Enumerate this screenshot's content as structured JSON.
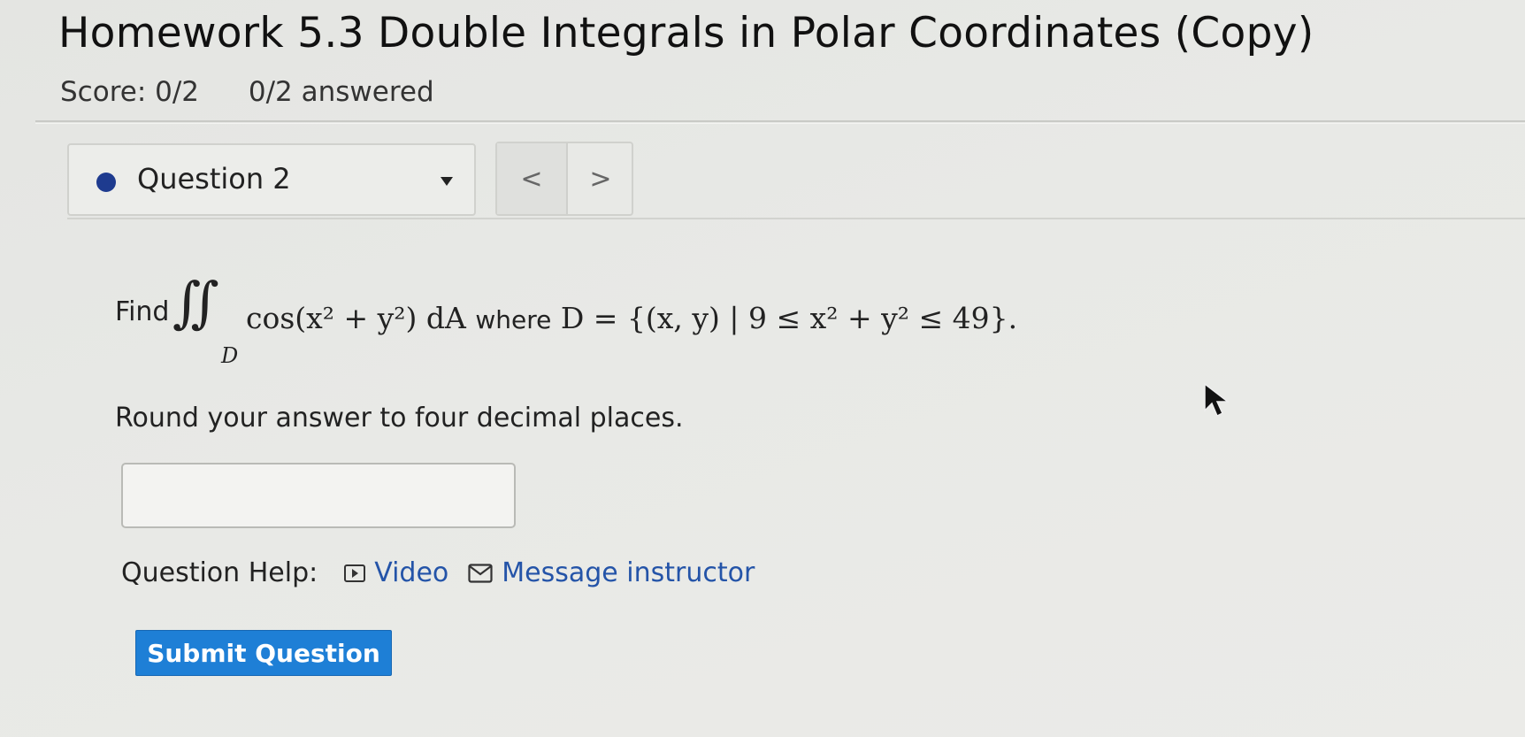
{
  "header": {
    "title": "Homework 5.3 Double Integrals in Polar Coordinates (Copy)",
    "score": "Score: 0/2",
    "answered": "0/2 answered"
  },
  "question_nav": {
    "selected": "Question 2",
    "prev_label": "<",
    "next_label": ">"
  },
  "question": {
    "find_label": "Find",
    "integral_symbol": "∬",
    "subscript": "D",
    "integrand": "cos(x² + y²) dA",
    "where_label": "where",
    "domain": "D = {(x, y) | 9 ≤ x² + y² ≤ 49}.",
    "instruction": "Round your answer to four decimal places.",
    "answer_value": ""
  },
  "help": {
    "label": "Question Help:",
    "video_label": "Video",
    "message_label": "Message instructor"
  },
  "actions": {
    "submit_label": "Submit Question"
  },
  "colors": {
    "accent": "#1e7fd6",
    "link": "#2454a8",
    "status_dot": "#1e3b8f"
  }
}
